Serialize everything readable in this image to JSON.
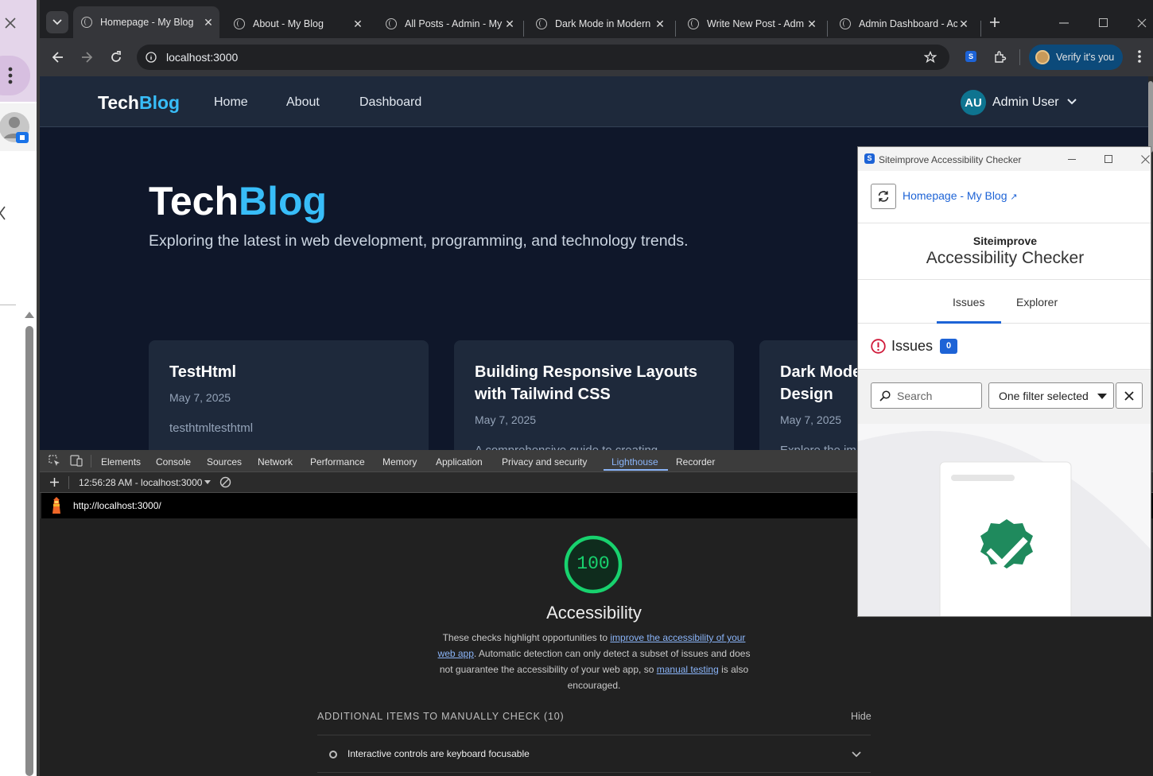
{
  "browser": {
    "tabs": [
      {
        "title": "Homepage - My Blog",
        "active": true
      },
      {
        "title": "About - My Blog",
        "active": false
      },
      {
        "title": "All Posts - Admin - My",
        "active": false
      },
      {
        "title": "Dark Mode in Modern",
        "active": false
      },
      {
        "title": "Write New Post - Adm",
        "active": false
      },
      {
        "title": "Admin Dashboard - Ac",
        "active": false
      }
    ],
    "url": "localhost:3000",
    "profile_badge": "S",
    "verify_label": "Verify it's you"
  },
  "site": {
    "logo_main": "Tech",
    "logo_accent": "Blog",
    "nav": [
      "Home",
      "About",
      "Dashboard"
    ],
    "user_initials": "AU",
    "user_name": "Admin User",
    "hero_sub": "Exploring the latest in web development, programming, and technology trends.",
    "cards": [
      {
        "title": "TestHtml",
        "date": "May 7, 2025",
        "excerpt": "testhtmltesthtml"
      },
      {
        "title": "Building Responsive Layouts with Tailwind CSS",
        "date": "May 7, 2025",
        "excerpt": "A comprehensive guide to creating"
      },
      {
        "title": "Dark Mode in Modern Web Design",
        "date": "May 7, 2025",
        "excerpt": "Explore the im"
      }
    ]
  },
  "devtools": {
    "tabs": [
      "Elements",
      "Console",
      "Sources",
      "Network",
      "Performance",
      "Memory",
      "Application",
      "Privacy and security",
      "Lighthouse",
      "Recorder"
    ],
    "active_tab": "Lighthouse",
    "report_select": "12:56:28 AM - localhost:3000",
    "report_url": "http://localhost:3000/",
    "score": "100",
    "category": "Accessibility",
    "desc_1": "These checks highlight opportunities to ",
    "desc_link1": "improve the accessibility of your web app",
    "desc_2": ". Automatic detection can only detect a subset of issues and does not guarantee the accessibility of your web app, so ",
    "desc_link2": "manual testing",
    "desc_3": " is also encouraged.",
    "manual_header": "ADDITIONAL ITEMS TO MANUALLY CHECK (10)",
    "hide_label": "Hide",
    "audit_item": "Interactive controls are keyboard focusable"
  },
  "siteimprove": {
    "window_title": "Siteimprove Accessibility Checker",
    "page_link": "Homepage - My Blog",
    "brand_top": "Siteimprove",
    "brand_bottom": "Accessibility Checker",
    "tabs": [
      "Issues",
      "Explorer"
    ],
    "issues_label": "Issues",
    "issues_count": "0",
    "search_placeholder": "Search",
    "filter_value": "One filter selected"
  },
  "colors": {
    "accent_blue": "#38bdf8",
    "page_bg": "#0f172a",
    "nav_bg": "#1e293b",
    "score_green": "#18d26e",
    "siteimprove_blue": "#1d63d6",
    "badge_green": "#1f8a5d"
  }
}
